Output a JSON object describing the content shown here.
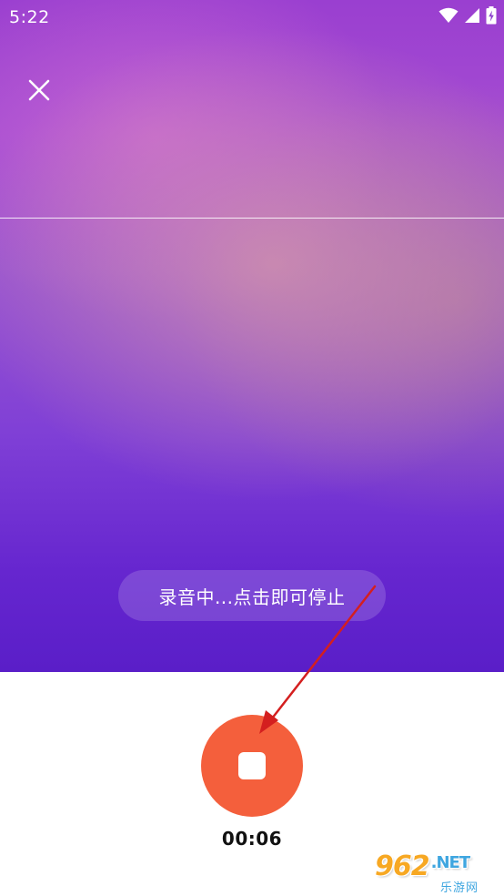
{
  "status_bar": {
    "time": "5:22",
    "icons": [
      "wifi-icon",
      "signal-icon",
      "battery-charging-icon"
    ]
  },
  "header": {
    "close_icon": "close-icon"
  },
  "recording": {
    "status_text": "录音中...点击即可停止",
    "timer": "00:06",
    "stop_icon": "stop-icon"
  },
  "colors": {
    "stop_button": "#f45f3c",
    "gradient_top": "#9a3fd0",
    "gradient_bottom": "#5a1ec8",
    "annotation_arrow": "#d41f1f"
  },
  "watermark": {
    "brand": "962",
    "domain_suffix": ".NET",
    "subtitle": "乐游网"
  }
}
